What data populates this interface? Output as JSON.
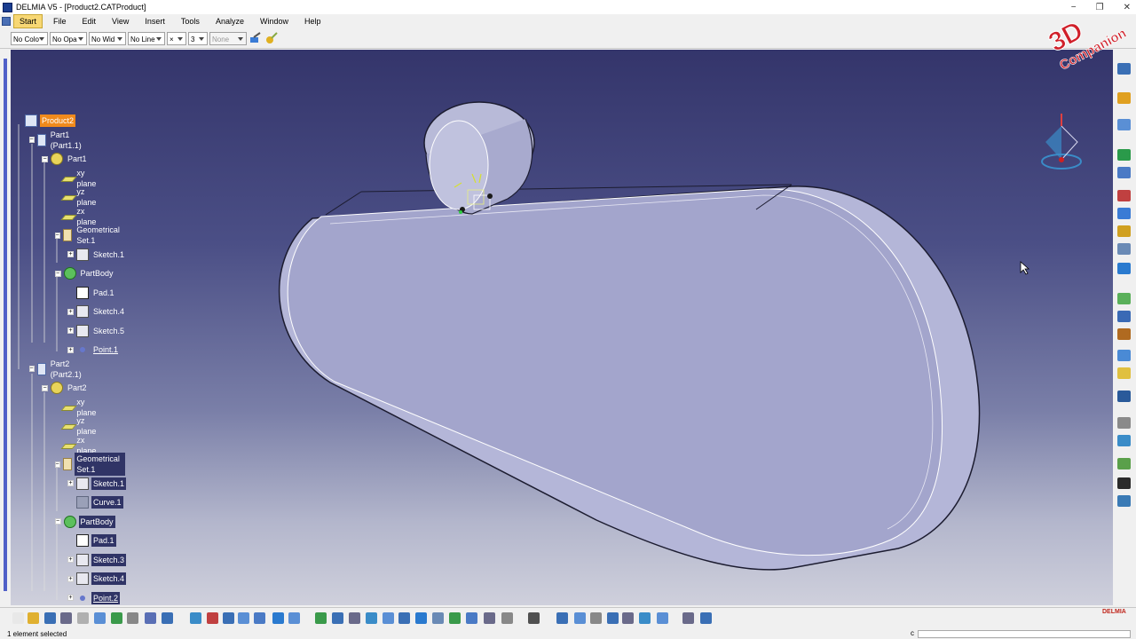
{
  "window": {
    "title": "DELMIA V5 - [Product2.CATProduct]",
    "controls": [
      "−",
      "❐",
      "✕"
    ]
  },
  "menu": [
    "Start",
    "File",
    "Edit",
    "View",
    "Insert",
    "Tools",
    "Analyze",
    "Window",
    "Help"
  ],
  "properties_toolbar": {
    "color": "No Colo",
    "opacity": "No Opa",
    "line_width": "No Wid",
    "line_type": "No Line",
    "point_symbol": "×",
    "layer_value": "3",
    "render_style": "None"
  },
  "tree": [
    {
      "label": "Product2",
      "icon": "product-icon",
      "level": 0,
      "selected": true,
      "pm": ""
    },
    {
      "label": "Part1 (Part1.1)",
      "icon": "product-icon",
      "level": 1,
      "pm": "−"
    },
    {
      "label": "Part1",
      "icon": "part-icon",
      "level": 2,
      "pm": "−"
    },
    {
      "label": "xy plane",
      "icon": "plane-icon",
      "level": 3,
      "pm": ""
    },
    {
      "label": "yz plane",
      "icon": "plane-icon",
      "level": 3,
      "pm": ""
    },
    {
      "label": "zx plane",
      "icon": "plane-icon",
      "level": 3,
      "pm": ""
    },
    {
      "label": "Geometrical Set.1",
      "icon": "geometrical-set-icon",
      "level": 3,
      "pm": "−"
    },
    {
      "label": "Sketch.1",
      "icon": "sketch-icon",
      "level": 4,
      "pm": "+"
    },
    {
      "label": "PartBody",
      "icon": "body-icon",
      "level": 3,
      "pm": "−"
    },
    {
      "label": "Pad.1",
      "icon": "pad-icon",
      "level": 4,
      "pm": ""
    },
    {
      "label": "Sketch.4",
      "icon": "sketch-icon",
      "level": 4,
      "pm": "+"
    },
    {
      "label": "Sketch.5",
      "icon": "sketch-icon",
      "level": 4,
      "pm": "+"
    },
    {
      "label": "Point.1",
      "icon": "point-icon",
      "level": 4,
      "pm": "+",
      "underline": true
    },
    {
      "label": "Part2 (Part2.1)",
      "icon": "product-icon",
      "level": 1,
      "pm": "−"
    },
    {
      "label": "Part2",
      "icon": "part-icon",
      "level": 2,
      "pm": "−"
    },
    {
      "label": "xy plane",
      "icon": "plane-icon",
      "level": 3,
      "pm": ""
    },
    {
      "label": "yz plane",
      "icon": "plane-icon",
      "level": 3,
      "pm": ""
    },
    {
      "label": "zx plane",
      "icon": "plane-icon",
      "level": 3,
      "pm": ""
    },
    {
      "label": "Geometrical Set.1",
      "icon": "geometrical-set-icon",
      "level": 3,
      "pm": "−",
      "highlight": true
    },
    {
      "label": "Sketch.1",
      "icon": "sketch-icon",
      "level": 4,
      "pm": "+",
      "highlight": true
    },
    {
      "label": "Curve.1",
      "icon": "curve-icon",
      "level": 4,
      "pm": "",
      "highlight": true
    },
    {
      "label": "PartBody",
      "icon": "body-icon",
      "level": 3,
      "pm": "−",
      "highlight": true
    },
    {
      "label": "Pad.1",
      "icon": "pad-icon",
      "level": 4,
      "pm": "",
      "highlight": true
    },
    {
      "label": "Sketch.3",
      "icon": "sketch-icon",
      "level": 4,
      "pm": "+",
      "highlight": true
    },
    {
      "label": "Sketch.4",
      "icon": "sketch-icon",
      "level": 4,
      "pm": "+",
      "highlight": true
    },
    {
      "label": "Point.2",
      "icon": "point-icon",
      "level": 4,
      "pm": "+",
      "highlight": true,
      "underline": true
    }
  ],
  "status": {
    "message": "1 element selected",
    "command_prompt_label": "c"
  },
  "branding": {
    "watermark_line1": "3D",
    "watermark_line2": "Companion",
    "logo": "DELMIA"
  },
  "colors": {
    "selection": "#f08a1c",
    "tree_highlight": "#303466",
    "part_face": "#a3a5cc",
    "part_side": "#b4b6d8",
    "menu_active": "#f7d774",
    "watermark": "#d0202a"
  }
}
